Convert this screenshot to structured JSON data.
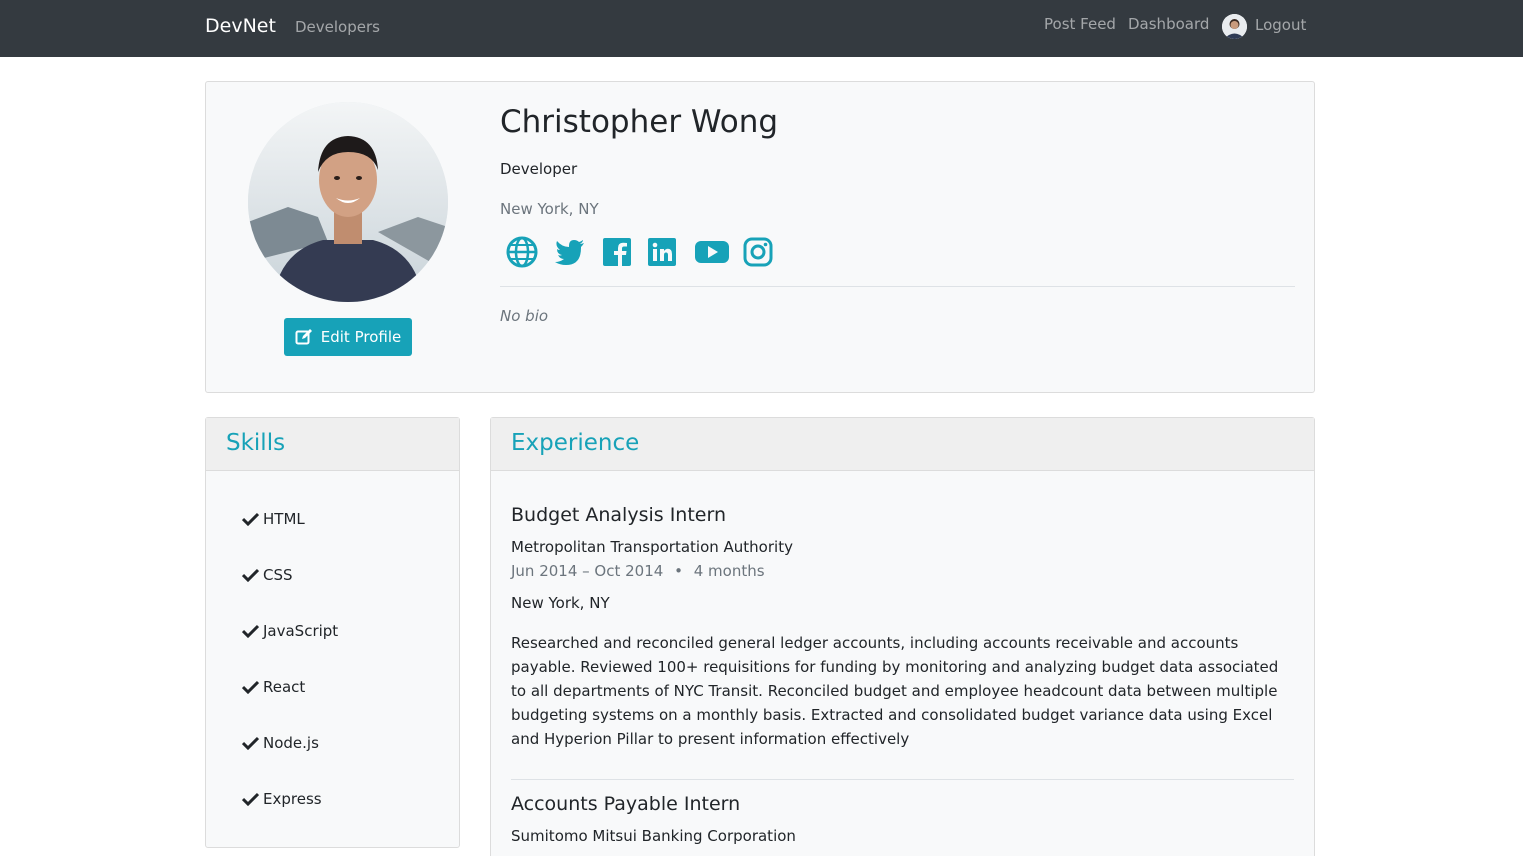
{
  "nav": {
    "brand": "DevNet",
    "developers": "Developers",
    "post_feed": "Post Feed",
    "dashboard": "Dashboard",
    "logout": "Logout"
  },
  "profile": {
    "name": "Christopher Wong",
    "status": "Developer",
    "location": "New York, NY",
    "bio": "No bio",
    "edit_button": "Edit Profile",
    "social_icons": [
      "globe-icon",
      "twitter-icon",
      "facebook-icon",
      "linkedin-icon",
      "youtube-icon",
      "instagram-icon"
    ]
  },
  "skills": {
    "title": "Skills",
    "items": [
      "HTML",
      "CSS",
      "JavaScript",
      "React",
      "Node.js",
      "Express"
    ]
  },
  "experience": {
    "title": "Experience",
    "items": [
      {
        "title": "Budget Analysis Intern",
        "company": "Metropolitan Transportation Authority",
        "dates": "Jun 2014 – Oct 2014",
        "duration": "4 months",
        "location": "New York, NY",
        "description": "Researched and reconciled general ledger accounts, including accounts receivable and accounts payable. Reviewed 100+ requisitions for funding by monitoring and analyzing budget data associated to all departments of NYC Transit. Reconciled budget and employee headcount data between multiple budgeting systems on a monthly basis. Extracted and consolidated budget variance data using Excel and Hyperion Pillar to present information effectively"
      },
      {
        "title": "Accounts Payable Intern",
        "company": "Sumitomo Mitsui Banking Corporation"
      }
    ]
  },
  "colors": {
    "accent": "#17a2b8",
    "navbar": "#343a40",
    "card_bg": "#f8f9fa"
  }
}
